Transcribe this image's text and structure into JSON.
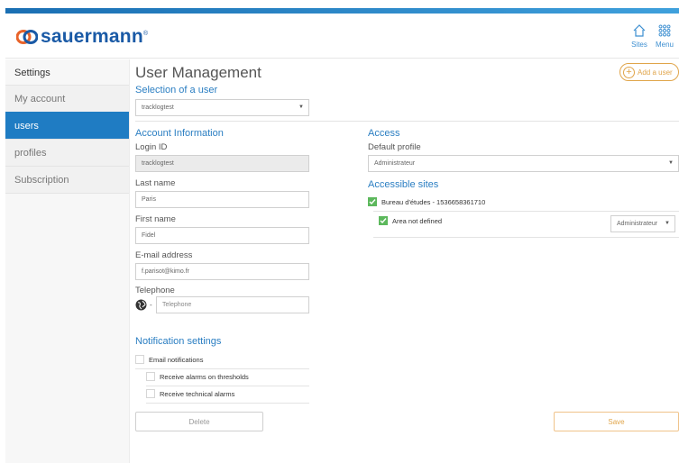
{
  "brand": {
    "name": "sauermann",
    "reg": "®"
  },
  "header": {
    "sites_label": "Sites",
    "menu_label": "Menu"
  },
  "sidebar": {
    "title": "Settings",
    "items": [
      {
        "label": "My account"
      },
      {
        "label": "users"
      },
      {
        "label": "profiles"
      },
      {
        "label": "Subscription"
      }
    ]
  },
  "page": {
    "title": "User Management",
    "add_user_label": "Add a user"
  },
  "selection": {
    "title": "Selection of a user",
    "selected_user": "tracklogtest"
  },
  "account": {
    "title": "Account Information",
    "login_label": "Login ID",
    "login_value": "tracklogtest",
    "lastname_label": "Last name",
    "lastname_value": "Paris",
    "firstname_label": "First name",
    "firstname_value": "Fidel",
    "email_label": "E-mail address",
    "email_value": "f.parisot@kimo.fr",
    "phone_label": "Telephone",
    "phone_prefix": "-",
    "phone_placeholder": "Telephone"
  },
  "access": {
    "title": "Access",
    "default_profile_label": "Default profile",
    "default_profile_value": "Administrateur",
    "sites_title": "Accessible sites",
    "site_name": "Bureau d'études - 1536658361710",
    "area_name": "Area not defined",
    "area_profile": "Administrateur"
  },
  "notifications": {
    "title": "Notification settings",
    "email_label": "Email notifications",
    "thresholds_label": "Receive alarms on thresholds",
    "technical_label": "Receive technical alarms"
  },
  "actions": {
    "delete_label": "Delete",
    "save_label": "Save"
  },
  "colors": {
    "accent": "#1f7cc3",
    "brand": "#1a5aa6",
    "orange": "#e0a54a",
    "check": "#5cb85c"
  },
  "icons": {
    "logo": "sauermann-logo-icon",
    "sites": "house-icon",
    "menu": "grid-icon",
    "phone": "globe-icon"
  }
}
